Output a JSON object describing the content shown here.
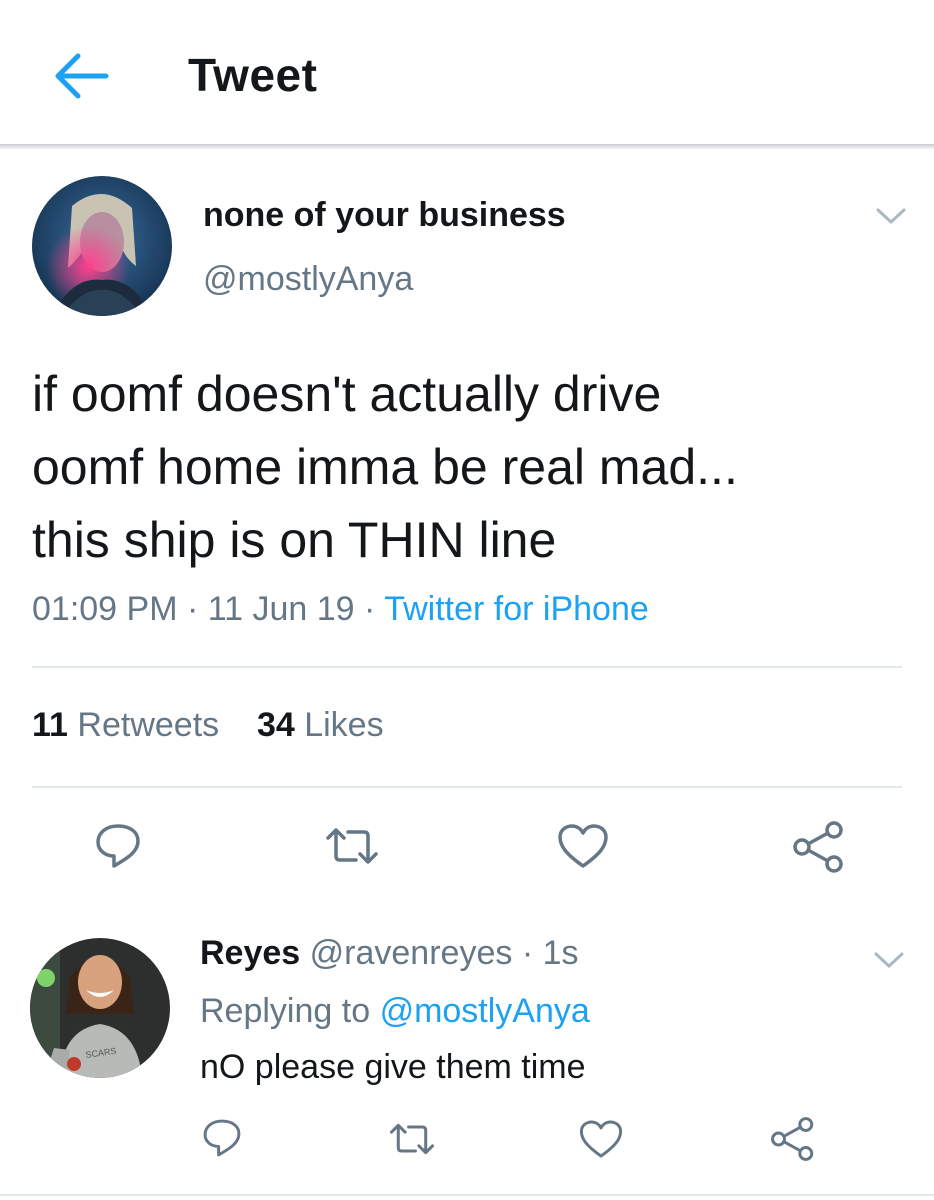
{
  "header": {
    "title": "Tweet",
    "accent": "#1da1f2"
  },
  "tweet": {
    "display_name": "none of your business",
    "handle": "@mostlyAnya",
    "text_lines": [
      "if oomf doesn't actually drive",
      "oomf home imma be real mad...",
      "this ship is on THIN line"
    ],
    "time": "01:09 PM",
    "date": "11 Jun 19",
    "separator": "·",
    "source": "Twitter for iPhone",
    "retweets_count": "11",
    "retweets_label": "Retweets",
    "likes_count": "34",
    "likes_label": "Likes",
    "actions": [
      "reply-icon",
      "retweet-icon",
      "like-icon",
      "share-icon"
    ]
  },
  "reply": {
    "display_name": "Reyes",
    "handle": "@ravenreyes",
    "separator": "·",
    "age": "1s",
    "replying_prefix": "Replying to",
    "replying_to": "@mostlyAnya",
    "text": "nO please give them time",
    "shirt_text": "SCARS"
  },
  "colors": {
    "link": "#1da1f2",
    "secondary": "#657786",
    "primary": "#14171a"
  }
}
